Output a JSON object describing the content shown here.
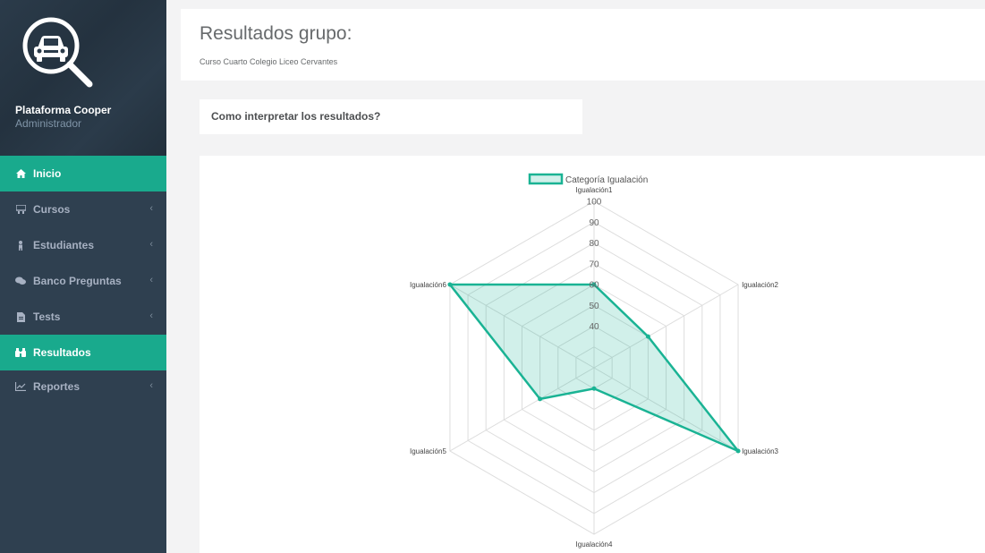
{
  "sidebar": {
    "profile": {
      "name": "Plataforma Cooper",
      "role": "Administrador"
    },
    "items": [
      {
        "label": "Inicio",
        "icon": "home-icon",
        "active": true,
        "has_arrow": false
      },
      {
        "label": "Cursos",
        "icon": "class-icon",
        "active": false,
        "has_arrow": true
      },
      {
        "label": "Estudiantes",
        "icon": "student-icon",
        "active": false,
        "has_arrow": true
      },
      {
        "label": "Banco Preguntas",
        "icon": "chat-icon",
        "active": false,
        "has_arrow": true
      },
      {
        "label": "Tests",
        "icon": "file-icon",
        "active": false,
        "has_arrow": true
      },
      {
        "label": "Resultados",
        "icon": "binoculars-icon",
        "active": true,
        "has_arrow": false
      },
      {
        "label": "Reportes",
        "icon": "line-chart-icon",
        "active": false,
        "has_arrow": true
      }
    ],
    "arrow_glyph": "‹"
  },
  "header": {
    "title": "Resultados grupo:",
    "subtitle": "Curso Cuarto Colegio Liceo Cervantes"
  },
  "interpret": {
    "title": "Como interpretar los resultados?"
  },
  "colors": {
    "accent": "#19aa8d",
    "sidebar": "#2f4050",
    "series_line": "#1ab394",
    "series_fill": "rgba(26,179,148,0.2)"
  },
  "chart_data": {
    "type": "radar",
    "categories": [
      "Igualación1",
      "Igualación2",
      "Igualación3",
      "Igualación4",
      "Igualación5",
      "Igualación6"
    ],
    "series": [
      {
        "name": "Categoría Igualación",
        "values": [
          60,
          50,
          100,
          30,
          50,
          100
        ]
      }
    ],
    "r_ticks": [
      40,
      50,
      60,
      70,
      80,
      90,
      100
    ],
    "rlim": [
      20,
      100
    ],
    "grid": true,
    "legend_position": "top"
  }
}
